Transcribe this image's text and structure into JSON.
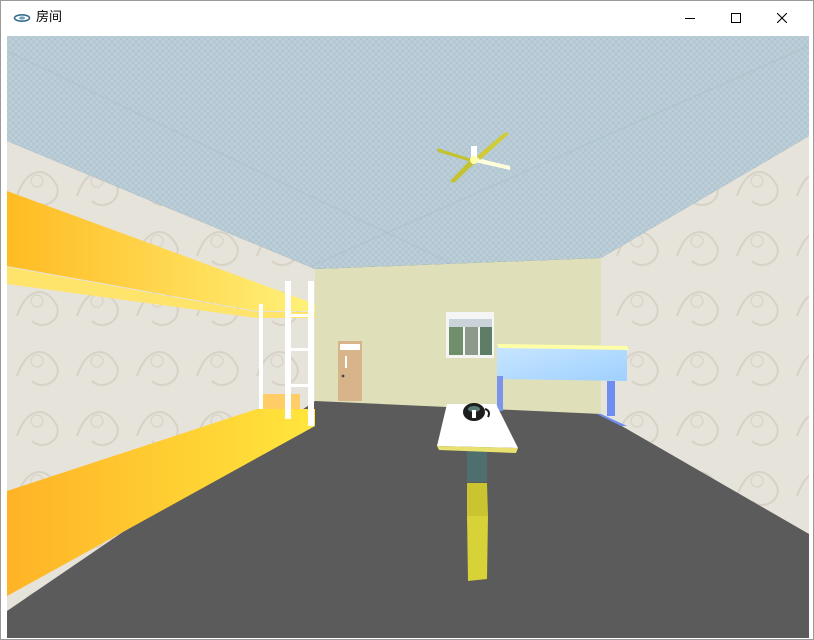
{
  "window": {
    "title": "房间",
    "app_icon": "glasses-app-icon",
    "controls": {
      "minimize": "minimize-icon",
      "maximize": "maximize-icon",
      "close": "close-icon"
    }
  },
  "scene": {
    "description_icons": [
      "ceiling-fan-icon",
      "bunk-bed",
      "door",
      "window",
      "desk",
      "table",
      "teapot"
    ],
    "colors": {
      "ceiling": "#b8ccd6",
      "wall_side": "#e3dfd6",
      "wall_back": "#dfdfb9",
      "floor": "#5b5b5b",
      "bed": "#ffc62a",
      "door": "#d9b58c",
      "desk": "#b4dcff",
      "desk_legs": "#6f8cf0",
      "table_top": "#ffffff",
      "table_leg": "#c9c42f"
    }
  }
}
